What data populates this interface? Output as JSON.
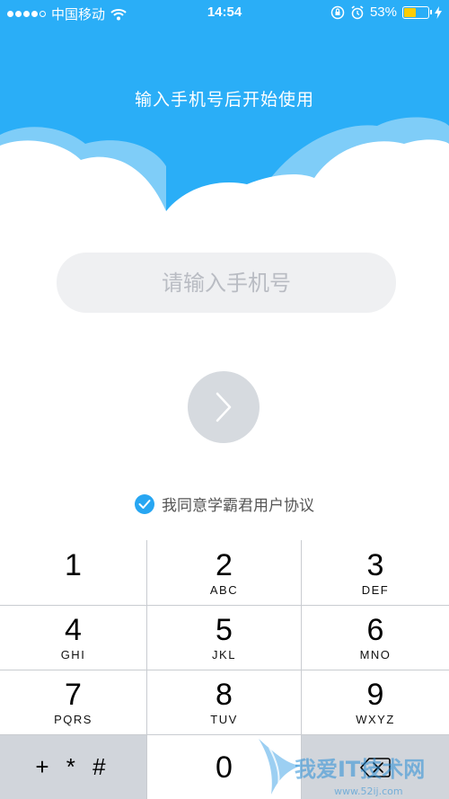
{
  "status_bar": {
    "carrier": "中国移动",
    "time": "14:54",
    "battery_percent": "53%",
    "battery_level": 0.53
  },
  "header": {
    "title": "输入手机号后开始使用"
  },
  "phone_input": {
    "placeholder": "请输入手机号",
    "value": ""
  },
  "agreement": {
    "checked": true,
    "text": "我同意学霸君用户协议"
  },
  "keypad": {
    "keys": [
      {
        "digit": "1",
        "letters": ""
      },
      {
        "digit": "2",
        "letters": "ABC"
      },
      {
        "digit": "3",
        "letters": "DEF"
      },
      {
        "digit": "4",
        "letters": "GHI"
      },
      {
        "digit": "5",
        "letters": "JKL"
      },
      {
        "digit": "6",
        "letters": "MNO"
      },
      {
        "digit": "7",
        "letters": "PQRS"
      },
      {
        "digit": "8",
        "letters": "TUV"
      },
      {
        "digit": "9",
        "letters": "WXYZ"
      }
    ],
    "symbols": "+ * #",
    "zero": "0"
  },
  "watermark": {
    "name": "我爱IT技术网",
    "url": "www.52ij.com"
  },
  "colors": {
    "sky": "#2aaef7",
    "accent": "#27a6f2",
    "input_bg": "#eff0f2",
    "button_disabled": "#d6dadf"
  }
}
